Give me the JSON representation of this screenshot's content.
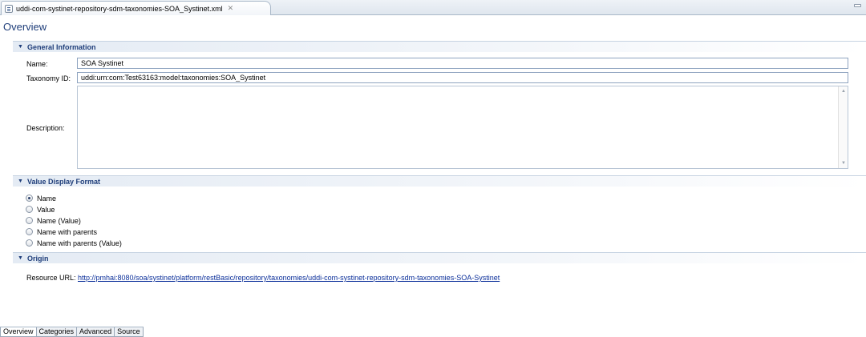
{
  "editor_tab": {
    "title": "uddi-com-systinet-repository-sdm-taxonomies-SOA_Systinet.xml",
    "close_glyph": "✕",
    "icon": "xml-file-icon"
  },
  "page": {
    "title": "Overview"
  },
  "general_information": {
    "header": "General Information",
    "name_label": "Name:",
    "name_value": "SOA Systinet",
    "taxonomy_id_label": "Taxonomy ID:",
    "taxonomy_id_value": "uddi:urn:com:Test63163:model:taxonomies:SOA_Systinet",
    "description_label": "Description:",
    "description_value": ""
  },
  "value_display_format": {
    "header": "Value Display Format",
    "options": [
      {
        "label": "Name",
        "checked": true
      },
      {
        "label": "Value",
        "checked": false
      },
      {
        "label": "Name (Value)",
        "checked": false
      },
      {
        "label": "Name with parents",
        "checked": false
      },
      {
        "label": "Name with parents (Value)",
        "checked": false
      }
    ]
  },
  "origin": {
    "header": "Origin",
    "resource_url_label": "Resource URL:",
    "resource_url": "http://pmhai:8080/soa/systinet/platform/restBasic/repository/taxonomies/uddi-com-systinet-repository-sdm-taxonomies-SOA-Systinet"
  },
  "bottom_tabs": [
    {
      "label": "Overview",
      "active": true
    },
    {
      "label": "Categories",
      "active": false
    },
    {
      "label": "Advanced",
      "active": false
    },
    {
      "label": "Source",
      "active": false
    }
  ],
  "colors": {
    "section_title": "#1f3e7a",
    "link": "#0b2f9a",
    "field_border": "#8fa4c0"
  }
}
